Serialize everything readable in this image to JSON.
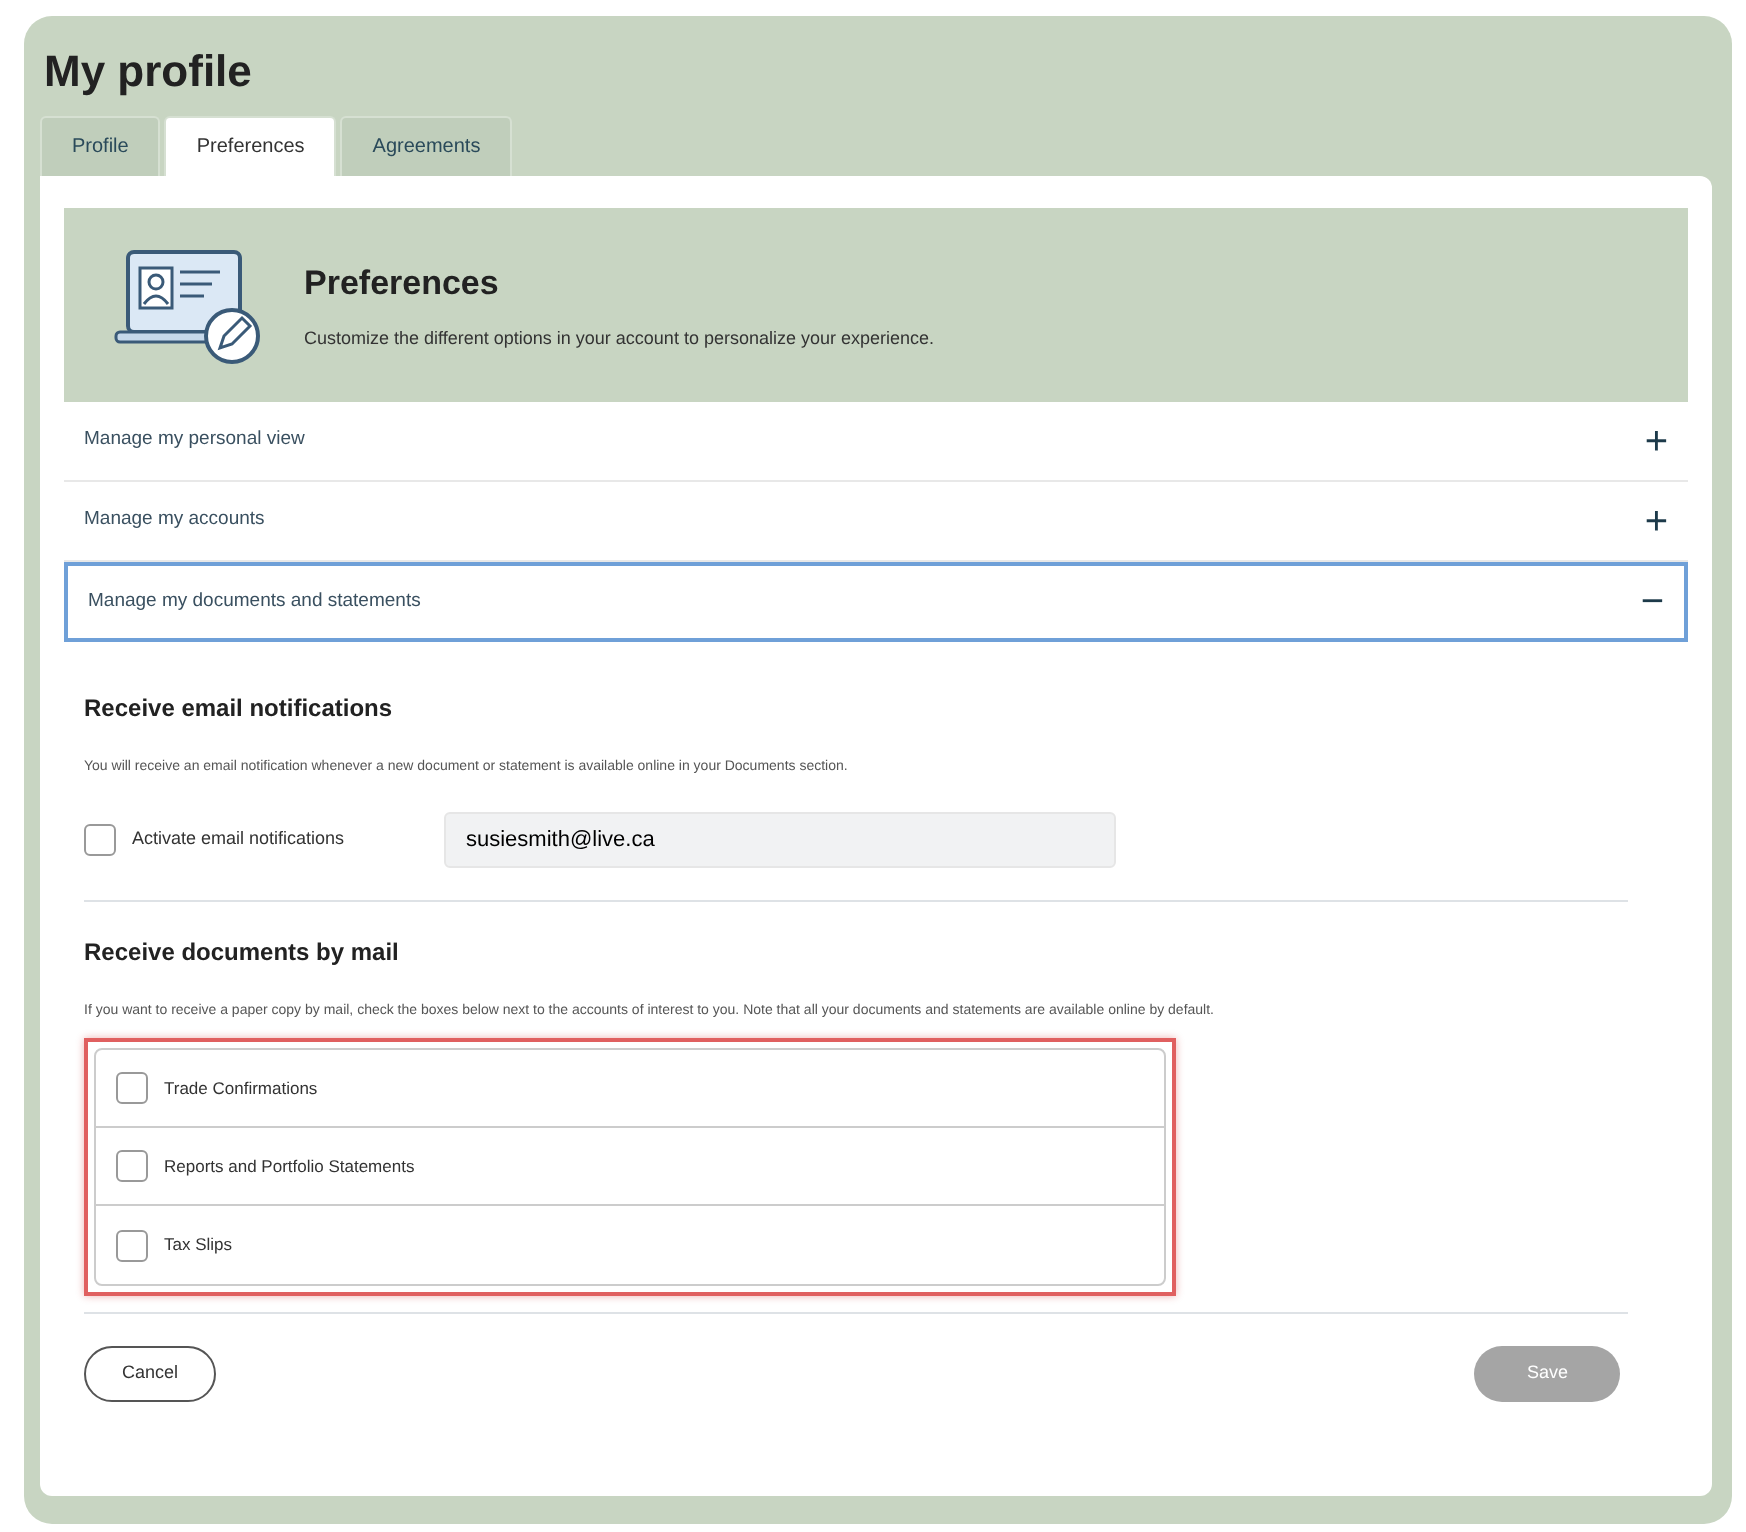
{
  "title": "My profile",
  "tabs": [
    {
      "label": "Profile",
      "selected": false
    },
    {
      "label": "Preferences",
      "selected": true
    },
    {
      "label": "Agreements",
      "selected": false
    }
  ],
  "banner": {
    "title": "Preferences",
    "subtitle": "Customize the different options in your account to personalize your experience."
  },
  "accordion": [
    {
      "label": "Manage my personal view",
      "expanded": false,
      "icon": "+"
    },
    {
      "label": "Manage my accounts",
      "expanded": false,
      "icon": "+"
    },
    {
      "label": "Manage my documents and statements",
      "expanded": true,
      "icon": "−"
    }
  ],
  "email_section": {
    "heading": "Receive email notifications",
    "description": "You will receive an email notification whenever a new document or statement is available online in your Documents section.",
    "checkbox": {
      "label": "Activate email notifications",
      "checked": false
    },
    "email": "susiesmith@live.ca"
  },
  "mail_section": {
    "heading": "Receive documents by mail",
    "description": "If you want to receive a paper copy by mail, check the boxes below next to the accounts of interest to you. Note that all your documents and statements are available online by default.",
    "highlighted": true,
    "options": [
      {
        "label": "Trade Confirmations",
        "checked": false
      },
      {
        "label": "Reports and Portfolio Statements",
        "checked": false
      },
      {
        "label": "Tax Slips",
        "checked": false
      }
    ]
  },
  "buttons": {
    "cancel": {
      "label": "Cancel"
    },
    "save": {
      "label": "Save",
      "disabled": true
    }
  }
}
